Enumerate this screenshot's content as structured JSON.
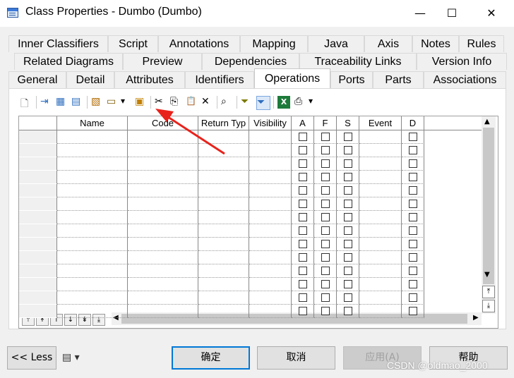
{
  "window": {
    "title": "Class Properties - Dumbo (Dumbo)",
    "minimize_glyph": "—",
    "maximize_glyph": "☐",
    "close_glyph": "✕"
  },
  "tabs": {
    "row1": [
      "Inner Classifiers",
      "Script",
      "Annotations",
      "Mapping",
      "Java",
      "Axis",
      "Notes",
      "Rules"
    ],
    "row2": [
      "Related Diagrams",
      "Preview",
      "Dependencies",
      "Traceability Links",
      "Version Info"
    ],
    "row3": [
      "General",
      "Detail",
      "Attributes",
      "Identifiers",
      "Operations",
      "Ports",
      "Parts",
      "Associations"
    ],
    "active": "Operations"
  },
  "toolbar": {
    "icons": [
      "properties-icon",
      "insert-row-icon",
      "add-row-icon",
      "add-rows-icon",
      "add-objects-icon",
      "create-icon",
      "dropdown-icon",
      "override-inherited-icon",
      "cut-icon",
      "copy-icon",
      "paste-icon",
      "delete-icon",
      "find-icon",
      "filter-icon",
      "filter-active-icon",
      "excel-export-icon",
      "print-icon",
      "print-dropdown-icon"
    ],
    "glyphs": [
      "🗋",
      "⇥",
      "▦",
      "▤",
      "▧",
      "▭",
      "▾",
      "▣",
      "✂",
      "⎘",
      "📋",
      "✕",
      "⌕",
      "⏷",
      "⏷",
      "X",
      "⎙",
      "▾"
    ]
  },
  "grid": {
    "columns": [
      "Name",
      "Code",
      "Return Typ",
      "Visibility",
      "A",
      "F",
      "S",
      "Event",
      "D"
    ],
    "row_count": 14
  },
  "nav_buttons": [
    "⤒",
    "↟",
    "↑",
    "↓",
    "↡",
    "⤓"
  ],
  "scroll": {
    "up": "▲",
    "down": "▼",
    "left": "◀",
    "right": "▶",
    "top": "⤒",
    "bottom": "⤓"
  },
  "footer": {
    "less_label": "<< Less",
    "ok_label": "确定",
    "cancel_label": "取消",
    "apply_label": "应用(A)",
    "help_label": "帮助"
  },
  "watermark": "CSDN @oldmao_2000",
  "colors": {
    "annotation_arrow": "#e8221b",
    "accent": "#0078d7"
  }
}
